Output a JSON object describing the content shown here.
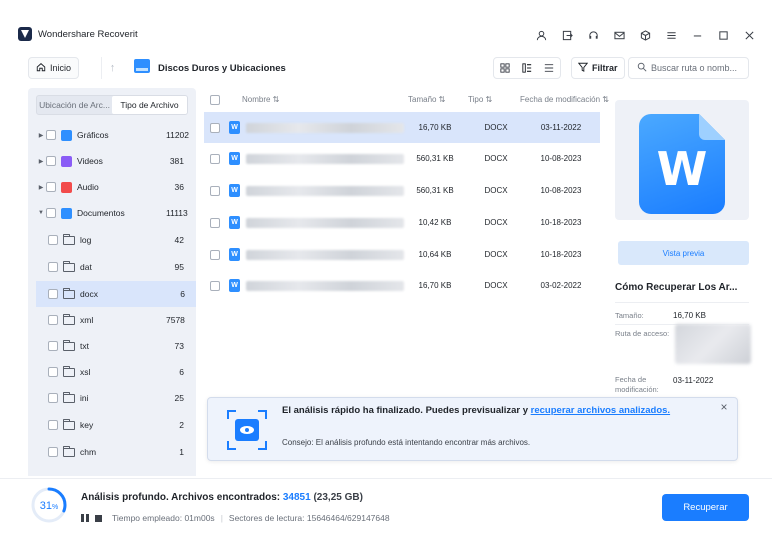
{
  "app": {
    "title": "Wondershare Recoverit",
    "window_icons": [
      "user-icon",
      "sign-in-icon",
      "headset-icon",
      "mail-icon",
      "cube-icon",
      "menu-icon",
      "minimize-icon",
      "maximize-icon",
      "close-icon"
    ]
  },
  "toolbar": {
    "home_label": "Inicio",
    "location_title": "Discos Duros y Ubicaciones",
    "filter_label": "Filtrar",
    "search_placeholder": "Buscar ruta o nomb..."
  },
  "sidebar": {
    "tabs": [
      {
        "label": "Ubicación de Arc...",
        "active": false
      },
      {
        "label": "Tipo de Archivo",
        "active": true
      }
    ],
    "items": [
      {
        "label": "Gráficos",
        "count": "11202",
        "icon": "image-icon",
        "color": "#2e8fff"
      },
      {
        "label": "Videos",
        "count": "381",
        "icon": "video-icon",
        "color": "#8a5cf6"
      },
      {
        "label": "Audio",
        "count": "36",
        "icon": "audio-icon",
        "color": "#f24b4b"
      },
      {
        "label": "Documentos",
        "count": "11113",
        "icon": "document-icon",
        "color": "#2e8fff"
      },
      {
        "label": "log",
        "count": "42"
      },
      {
        "label": "dat",
        "count": "95"
      },
      {
        "label": "docx",
        "count": "6"
      },
      {
        "label": "xml",
        "count": "7578"
      },
      {
        "label": "txt",
        "count": "73"
      },
      {
        "label": "xsl",
        "count": "6"
      },
      {
        "label": "ini",
        "count": "25"
      },
      {
        "label": "key",
        "count": "2"
      },
      {
        "label": "chm",
        "count": "1"
      }
    ]
  },
  "list": {
    "headers": {
      "name": "Nombre ⇅",
      "size": "Tamaño ⇅",
      "type": "Tipo ⇅",
      "date": "Fecha de modificación ⇅"
    },
    "rows": [
      {
        "size": "16,70 KB",
        "type": "DOCX",
        "date": "03-11-2022",
        "selected": true
      },
      {
        "size": "560,31 KB",
        "type": "DOCX",
        "date": "10-08-2023",
        "selected": false
      },
      {
        "size": "560,31 KB",
        "type": "DOCX",
        "date": "10-08-2023",
        "selected": false
      },
      {
        "size": "10,42 KB",
        "type": "DOCX",
        "date": "10-18-2023",
        "selected": false
      },
      {
        "size": "10,64 KB",
        "type": "DOCX",
        "date": "10-18-2023",
        "selected": false
      },
      {
        "size": "16,70 KB",
        "type": "DOCX",
        "date": "03-02-2022",
        "selected": false
      }
    ],
    "file_letter": "W"
  },
  "details": {
    "preview_letter": "W",
    "preview_button": "Vista previa",
    "howto": "Cómo Recuperar Los Ar...",
    "size_label": "Tamaño:",
    "size_value": "16,70 KB",
    "path_label": "Ruta de acceso:",
    "date_label_1": "Fecha de",
    "date_label_2": "modificación:",
    "date_value": "03-11-2022"
  },
  "notice": {
    "main_text": "El análisis rápido ha finalizado. Puedes previsualizar y ",
    "link_text": "recuperar archivos analizados.",
    "tip": "Consejo: El análisis profundo está intentando encontrar más archivos."
  },
  "status": {
    "percent_number": "31",
    "percent_sign": "%",
    "progress": 0.31,
    "line_prefix": "Análisis profundo. Archivos encontrados: ",
    "count": "34851",
    "size": " (23,25 GB)",
    "time_label": "Tiempo empleado: 01m00s",
    "sectors_label": "Sectores de lectura: 15646464/629147648",
    "recover_label": "Recuperar"
  },
  "colors": {
    "accent": "#1a7dff",
    "selected_row": "#d9e5fb",
    "sidebar_bg": "#eef1f7"
  }
}
